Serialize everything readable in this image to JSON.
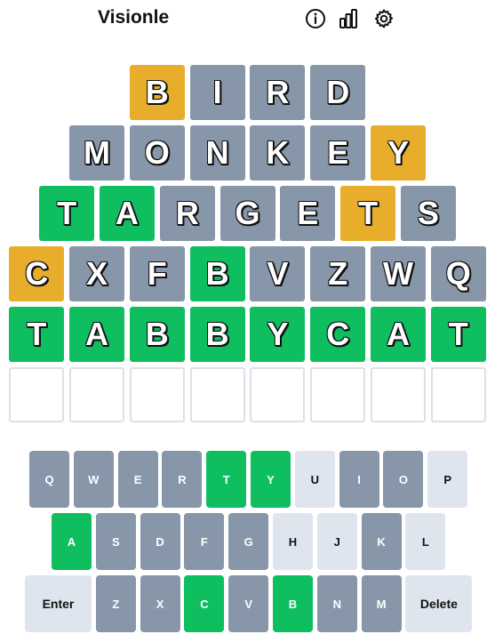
{
  "app": {
    "title": "Visionle"
  },
  "header_icons": [
    "info-icon",
    "stats-icon",
    "gear-icon"
  ],
  "colors": {
    "absent": "#8796a8",
    "present": "#e9ad2c",
    "correct": "#0fbe5f",
    "unused_key": "#dfe5ee",
    "empty_border": "#dbe1e7"
  },
  "board": {
    "rows": [
      {
        "letters": [
          "B",
          "I",
          "R",
          "D"
        ],
        "states": [
          "present",
          "absent",
          "absent",
          "absent"
        ]
      },
      {
        "letters": [
          "M",
          "O",
          "N",
          "K",
          "E",
          "Y"
        ],
        "states": [
          "absent",
          "absent",
          "absent",
          "absent",
          "absent",
          "present"
        ]
      },
      {
        "letters": [
          "T",
          "A",
          "R",
          "G",
          "E",
          "T",
          "S"
        ],
        "states": [
          "correct",
          "correct",
          "absent",
          "absent",
          "absent",
          "present",
          "absent"
        ]
      },
      {
        "letters": [
          "C",
          "X",
          "F",
          "B",
          "V",
          "Z",
          "W",
          "Q"
        ],
        "states": [
          "present",
          "absent",
          "absent",
          "correct",
          "absent",
          "absent",
          "absent",
          "absent"
        ]
      },
      {
        "letters": [
          "T",
          "A",
          "B",
          "B",
          "Y",
          "C",
          "A",
          "T"
        ],
        "states": [
          "correct",
          "correct",
          "correct",
          "correct",
          "correct",
          "correct",
          "correct",
          "correct"
        ]
      },
      {
        "letters": [
          "",
          "",
          "",
          "",
          "",
          "",
          "",
          ""
        ],
        "states": [
          "empty",
          "empty",
          "empty",
          "empty",
          "empty",
          "empty",
          "empty",
          "empty"
        ]
      }
    ]
  },
  "keyboard": {
    "rows": [
      [
        {
          "label": "Q",
          "state": "absent"
        },
        {
          "label": "W",
          "state": "absent"
        },
        {
          "label": "E",
          "state": "absent"
        },
        {
          "label": "R",
          "state": "absent"
        },
        {
          "label": "T",
          "state": "correct"
        },
        {
          "label": "Y",
          "state": "correct"
        },
        {
          "label": "U",
          "state": "unused"
        },
        {
          "label": "I",
          "state": "absent"
        },
        {
          "label": "O",
          "state": "absent"
        },
        {
          "label": "P",
          "state": "unused"
        }
      ],
      [
        {
          "label": "A",
          "state": "correct"
        },
        {
          "label": "S",
          "state": "absent"
        },
        {
          "label": "D",
          "state": "absent"
        },
        {
          "label": "F",
          "state": "absent"
        },
        {
          "label": "G",
          "state": "absent"
        },
        {
          "label": "H",
          "state": "unused"
        },
        {
          "label": "J",
          "state": "unused"
        },
        {
          "label": "K",
          "state": "absent"
        },
        {
          "label": "L",
          "state": "unused"
        }
      ],
      [
        {
          "label": "Enter",
          "state": "unused",
          "wide": true
        },
        {
          "label": "Z",
          "state": "absent"
        },
        {
          "label": "X",
          "state": "absent"
        },
        {
          "label": "C",
          "state": "correct"
        },
        {
          "label": "V",
          "state": "absent"
        },
        {
          "label": "B",
          "state": "correct"
        },
        {
          "label": "N",
          "state": "absent"
        },
        {
          "label": "M",
          "state": "absent"
        },
        {
          "label": "Delete",
          "state": "unused",
          "wide": true
        }
      ]
    ]
  }
}
